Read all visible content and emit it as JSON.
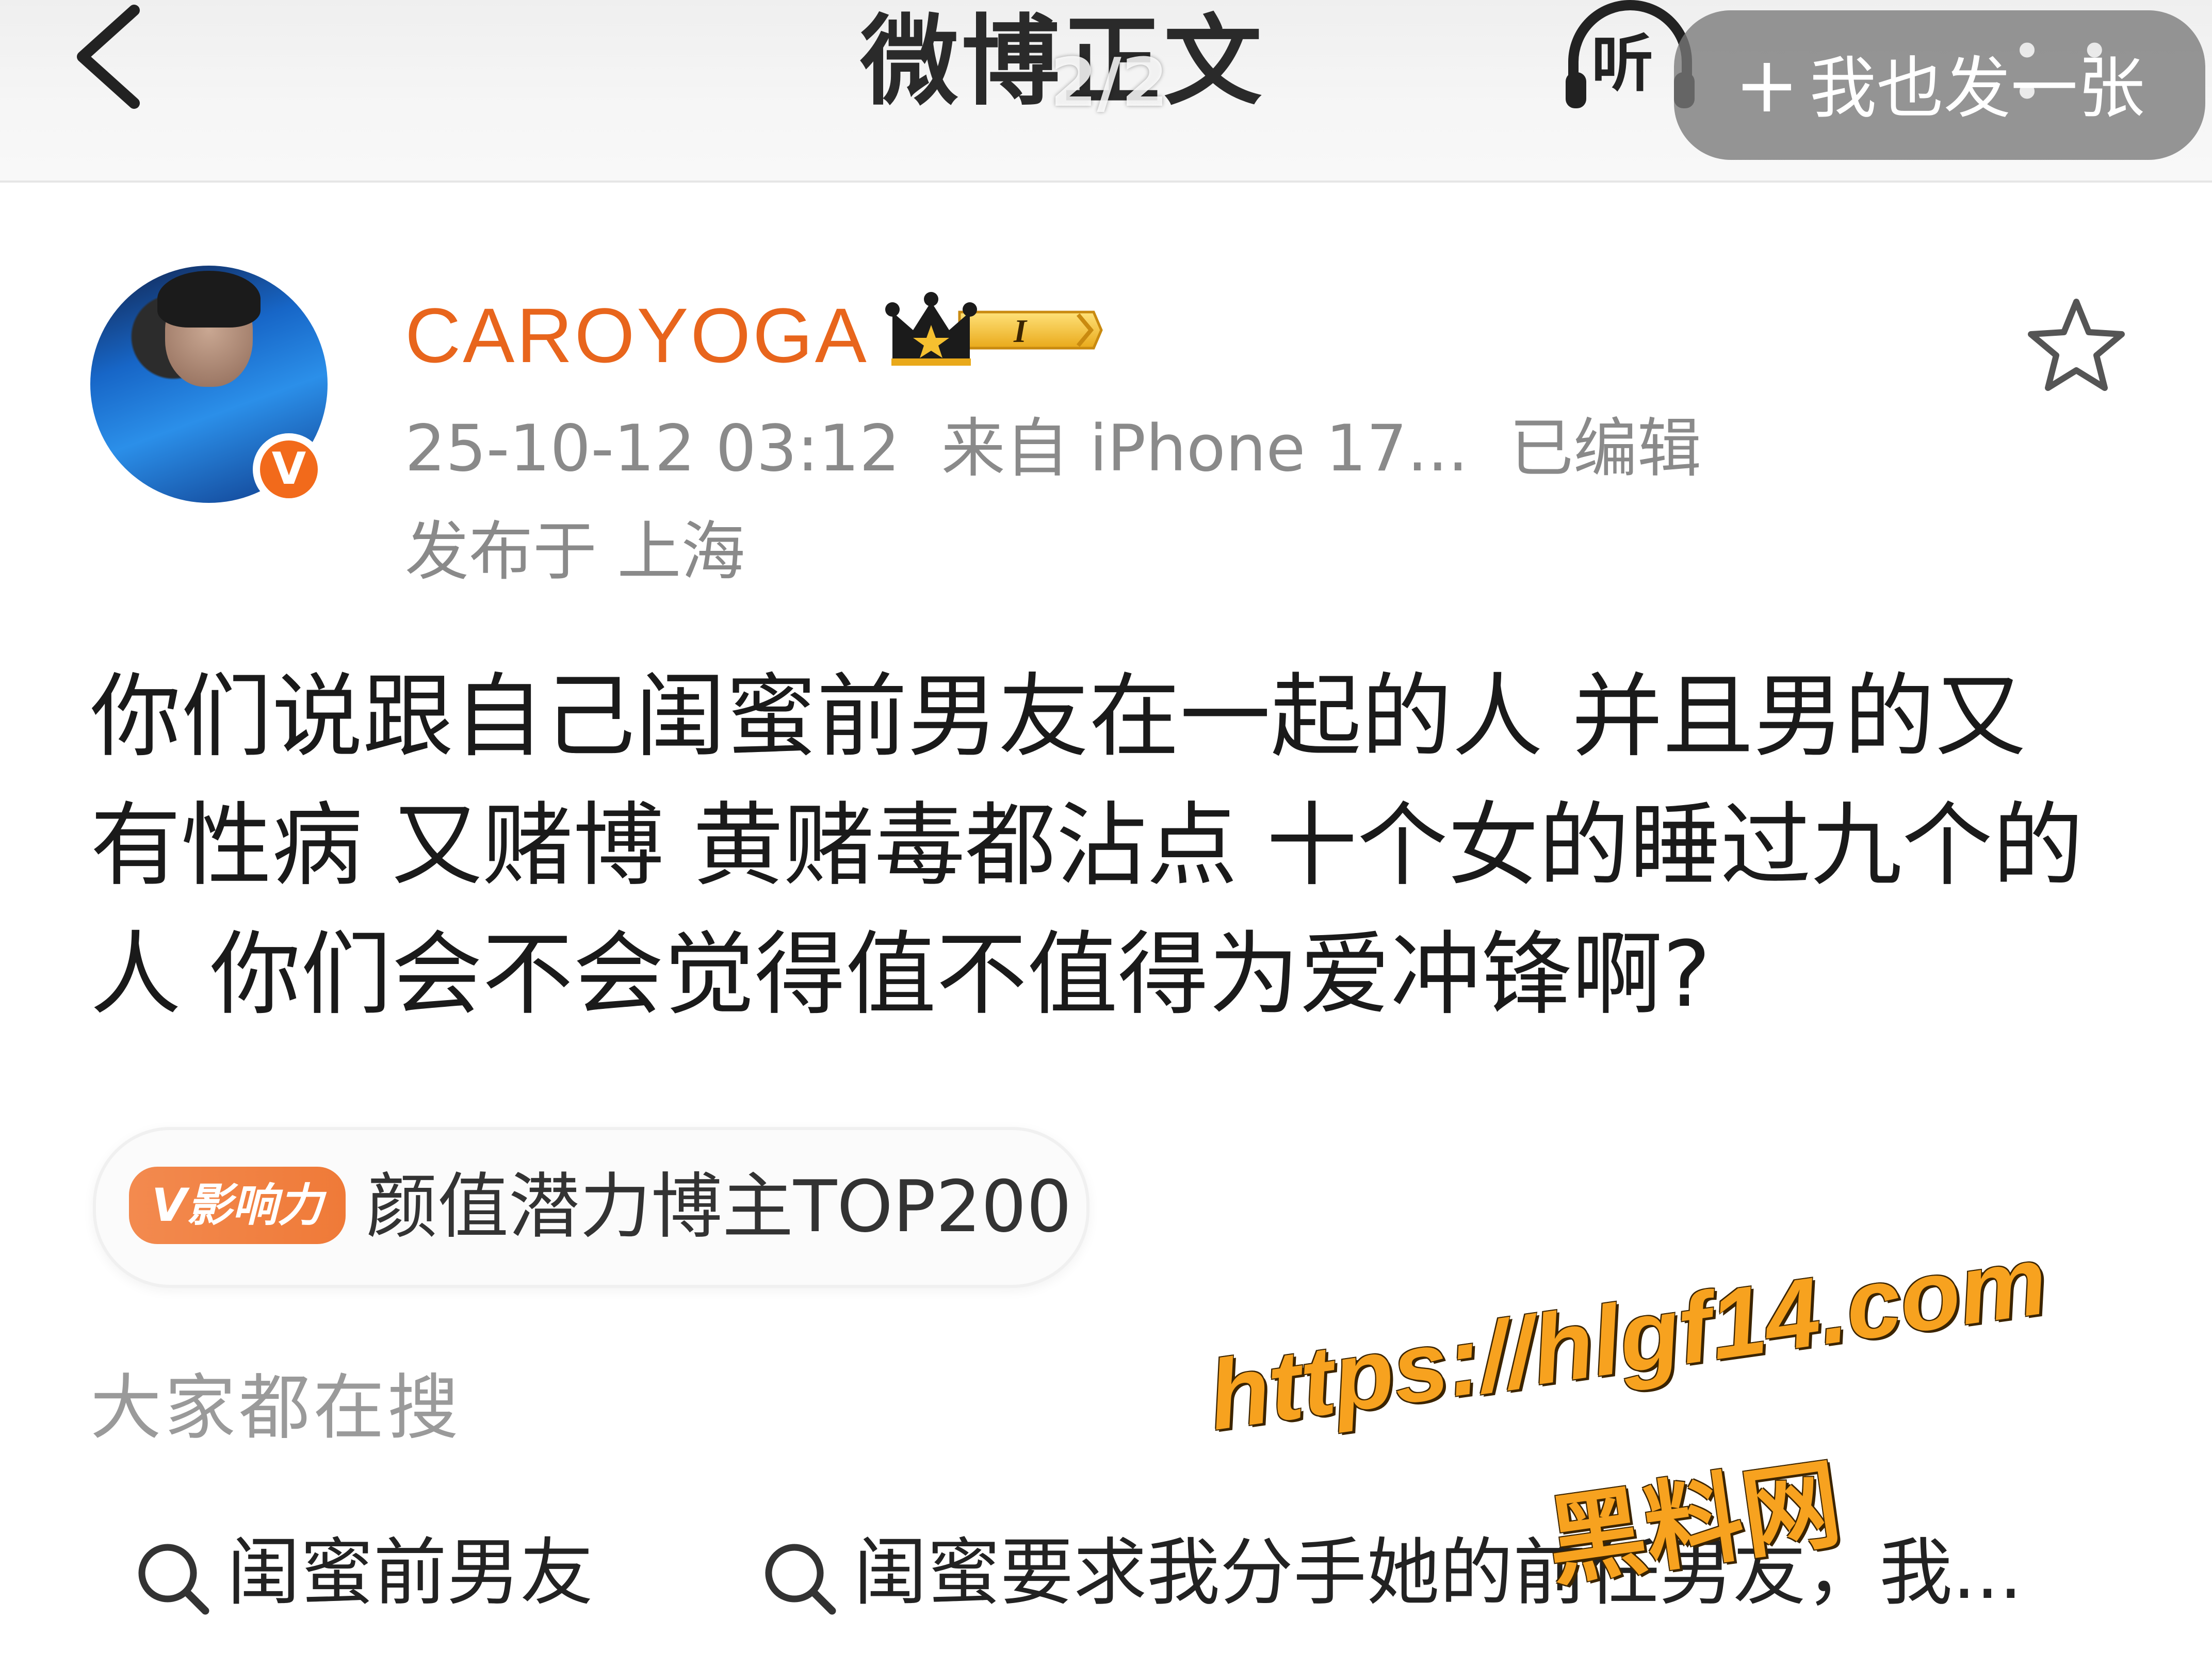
{
  "nav": {
    "title": "微博正文",
    "page_counter": "2/2",
    "listen_label": "听",
    "post_photo_label": "我也发一张",
    "post_photo_plus": "+",
    "more_dots": "• • •"
  },
  "author": {
    "username": "CAROYOGA",
    "verified_mark": "V",
    "level_badge": "I",
    "timestamp": "25-10-12 03:12",
    "source": "来自 iPhone 17...",
    "edited": "已编辑",
    "location": "发布于 上海"
  },
  "post": {
    "text": "你们说跟自己闺蜜前男友在一起的人 并且男的又有性病 又赌博 黄赌毒都沾点 十个女的睡过九个的人 你们会不会觉得值不值得为爱冲锋啊?"
  },
  "influence": {
    "badge": "V影响力",
    "label": "颜值潜力博主TOP200"
  },
  "searches": {
    "heading": "大家都在搜",
    "items": [
      {
        "label": "闺蜜前男友"
      },
      {
        "label": "闺蜜要求我分手她的前任男友，我..."
      }
    ]
  },
  "watermark": {
    "url": "https://hlgf14.com",
    "site": "黑料网"
  },
  "colors": {
    "brand_orange": "#e8651c",
    "verified": "#f26a1b",
    "watermark": "#f7a21f",
    "meta_gray": "#8a8a8a"
  },
  "icons": [
    "back-chevron-icon",
    "headphones-icon",
    "star-outline-icon",
    "crown-icon",
    "search-icon"
  ]
}
